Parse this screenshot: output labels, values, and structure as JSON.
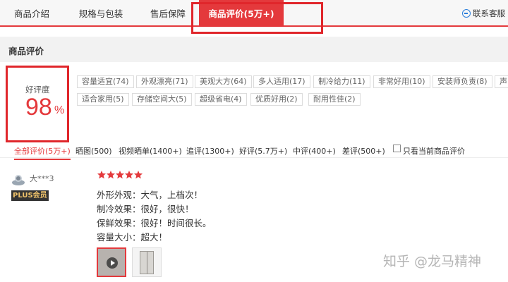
{
  "tabs": [
    {
      "label": "商品介绍"
    },
    {
      "label": "规格与包装"
    },
    {
      "label": "售后保障"
    },
    {
      "label": "商品评价(5万+)"
    }
  ],
  "service_label": "联系客服",
  "section_title": "商品评价",
  "rating": {
    "label": "好评度",
    "value": "98",
    "unit": "%"
  },
  "tags": [
    "容量适宜(74)",
    "外观漂亮(71)",
    "美观大方(64)",
    "多人适用(17)",
    "制冷给力(11)",
    "非常好用(10)",
    "安装师负责(8)",
    "声",
    "适合家用(5)",
    "存储空间大(5)",
    "超级省电(4)",
    "优质好用(2)",
    "耐用性佳(2)"
  ],
  "filters": [
    "全部评价(5万+)",
    "晒图(500)",
    "视频晒单(1400+)",
    "追评(1300+)",
    "好评(5.7万+)",
    "中评(400+)",
    "差评(500+)"
  ],
  "current_only_label": "只看当前商品评价",
  "comment": {
    "user": "大***3",
    "badge": "PLUS会员",
    "stars": 5,
    "lines": [
      "外形外观：大气，上档次！",
      "制冷效果：很好，很快！",
      "保鲜效果：很好！时间很长。",
      "容量大小：超大！"
    ]
  },
  "watermark": "知乎 @龙马精神",
  "colors": {
    "accent": "#e4393c",
    "highlight": "#e0262b"
  }
}
